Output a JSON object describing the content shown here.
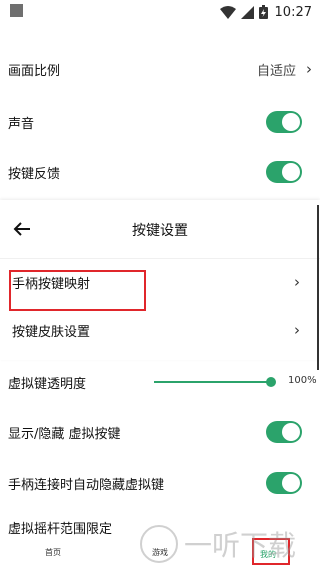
{
  "status_bar": {
    "time": "10:27"
  },
  "settings": {
    "aspect_ratio": {
      "label": "画面比例",
      "value": "自适应"
    },
    "sound": {
      "label": "声音",
      "enabled": true
    },
    "key_feedback": {
      "label": "按键反馈",
      "enabled": true
    }
  },
  "key_panel": {
    "title": "按键设置",
    "items": [
      {
        "label": "手柄按键映射"
      },
      {
        "label": "按键皮肤设置"
      }
    ]
  },
  "virtual_keys": {
    "opacity": {
      "label": "虚拟键透明度",
      "value_text": "100%",
      "value": 1.0
    },
    "show_hide": {
      "label": "显示/隐藏 虚拟按键",
      "enabled": true
    },
    "auto_hide_on_gamepad": {
      "label": "手柄连接时自动隐藏虚拟键",
      "enabled": true
    },
    "joystick_range": {
      "label": "虚拟摇杆范围限定"
    }
  },
  "bottom_nav": {
    "home": "首页",
    "games": "游戏",
    "mine": "我的"
  },
  "watermark": {
    "text": "一听下载"
  },
  "colors": {
    "accent": "#2ba36b",
    "highlight": "#e0262b"
  }
}
